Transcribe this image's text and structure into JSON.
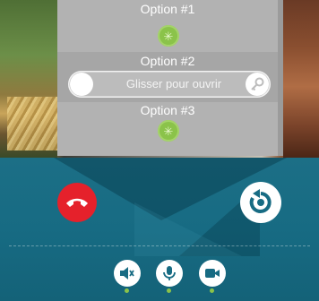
{
  "options": [
    {
      "label": "Option #1"
    },
    {
      "label": "Option #2"
    },
    {
      "label": "Option #3"
    }
  ],
  "slider": {
    "text": "Glisser pour ouvrir",
    "key_icon": "key-icon"
  },
  "colors": {
    "panel": "#b2b2b2",
    "accent_green": "#8bc34a",
    "hangup_red": "#e5212b",
    "call_background": "#176b83"
  },
  "call_controls": [
    {
      "name": "speaker-icon"
    },
    {
      "name": "microphone-icon"
    },
    {
      "name": "video-camera-icon"
    }
  ],
  "actions": {
    "hangup": "hangup-icon",
    "redial": "redial-icon"
  }
}
